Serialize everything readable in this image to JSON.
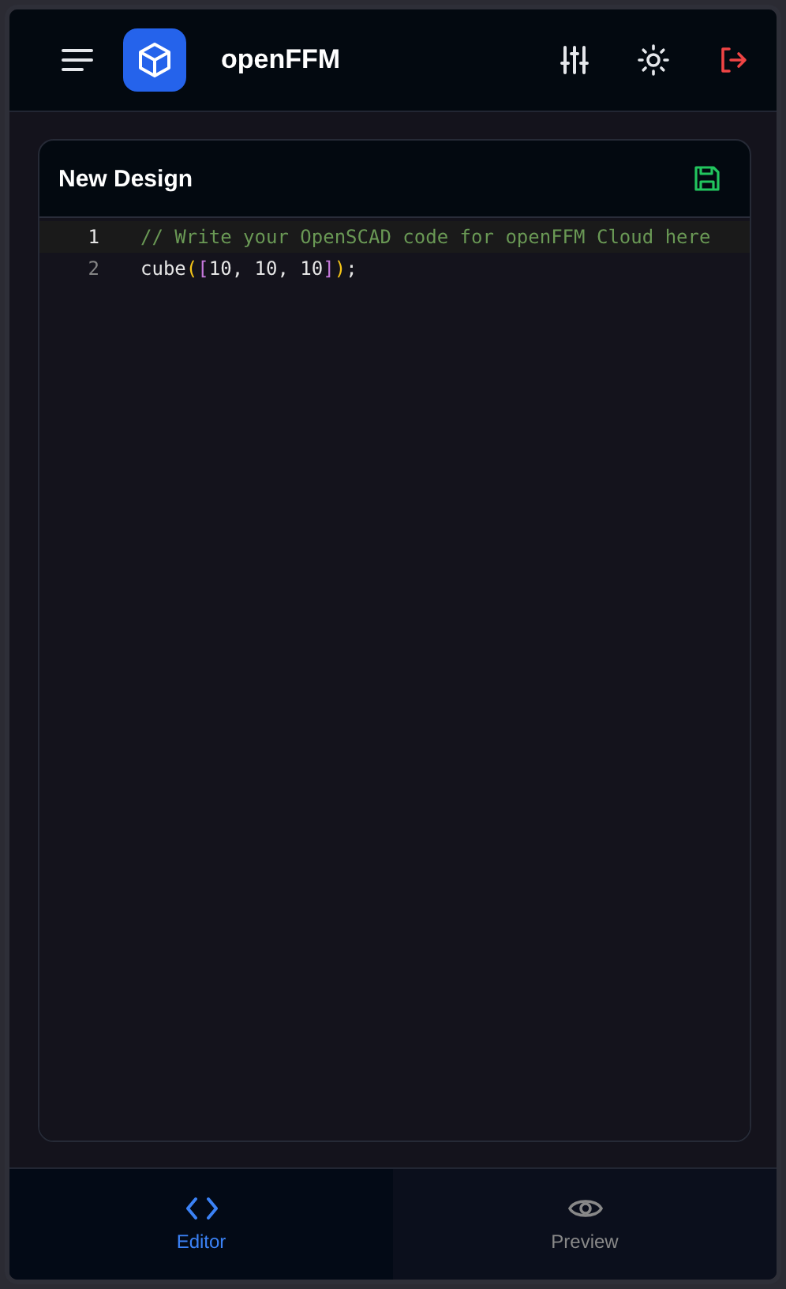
{
  "header": {
    "title": "openFFM"
  },
  "editor": {
    "title": "New Design",
    "lines": [
      {
        "number": "1",
        "active": true,
        "tokens": [
          {
            "kind": "comment",
            "text": "// Write your OpenSCAD code for openFFM Cloud here"
          }
        ]
      },
      {
        "number": "2",
        "active": false,
        "tokens": [
          {
            "kind": "plain",
            "text": "cube"
          },
          {
            "kind": "paren",
            "text": "("
          },
          {
            "kind": "bracket",
            "text": "["
          },
          {
            "kind": "plain",
            "text": "10, 10, 10"
          },
          {
            "kind": "bracket",
            "text": "]"
          },
          {
            "kind": "paren",
            "text": ")"
          },
          {
            "kind": "plain",
            "text": ";"
          }
        ]
      }
    ]
  },
  "nav": [
    {
      "label": "Editor",
      "kind": "code",
      "selected": true
    },
    {
      "label": "Preview",
      "kind": "view",
      "selected": false
    }
  ]
}
